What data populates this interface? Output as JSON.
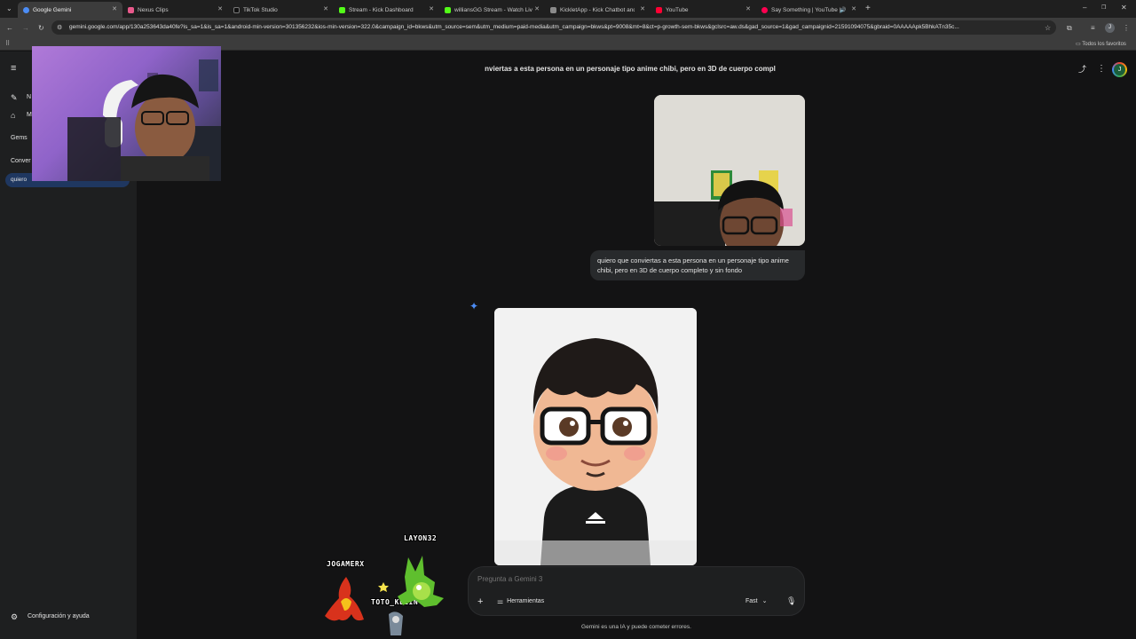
{
  "browser": {
    "tabs": [
      {
        "title": "Google Gemini",
        "color": "#4c8df6",
        "active": true
      },
      {
        "title": "Nexus Clips",
        "color": "#e8598b"
      },
      {
        "title": "TikTok Studio",
        "color": "#222222"
      },
      {
        "title": "Stream - Kick Dashboard",
        "color": "#53fc18"
      },
      {
        "title": "williansGG Stream - Watch Live",
        "color": "#53fc18"
      },
      {
        "title": "KickletApp - Kick Chatbot and",
        "color": "#8a8a8a"
      },
      {
        "title": "YouTube",
        "color": "#ff0033"
      },
      {
        "title": "Say Something | YouTube |...",
        "color": "#ff0050"
      }
    ],
    "url": "gemini.google.com/app/130a253643da40fe?is_sa=1&is_sa=1&android-min-version=301356232&ios-min-version=322.0&campaign_id=bkws&utm_source=sem&utm_medium=paid-media&utm_campaign=bkws&pt=9008&mt=8&ct=p-growth-sem-bkws&gclsrc=aw.ds&gad_source=1&gad_campaignid=21591094075&gbraid=0AAAAApk5BhkATn35c...",
    "bookmarks_label": "Todos los favoritos",
    "profile_initial": "J"
  },
  "sidebar": {
    "items_visible": [
      "N",
      "M"
    ],
    "gems_label": "Gems",
    "conversations_label": "Conver",
    "recent_chat_label": "quiero",
    "settings_label": "Configuración y ayuda"
  },
  "chat": {
    "title": "nviertas a esta persona en un personaje tipo anime chibi, pero en 3D de cuerpo compl",
    "user_message": "quiero que conviertas a esta persona en un personaje tipo anime chibi, pero en 3D de cuerpo completo y sin fondo",
    "avatar_initial": "J"
  },
  "composer": {
    "placeholder": "Pregunta a Gemini 3",
    "tools_label": "Herramientas",
    "mode_label": "Fast"
  },
  "disclaimer": "Gemini es una IA y puede cometer errores.",
  "stream_overlay": {
    "names": [
      "LAYON32",
      "JOGAMERX",
      "TOTO_KLEIN"
    ]
  },
  "colors": {
    "accent": "#4c8df6",
    "background": "#131314",
    "sidebar": "#1e1f20",
    "kick_green": "#53fc18"
  }
}
